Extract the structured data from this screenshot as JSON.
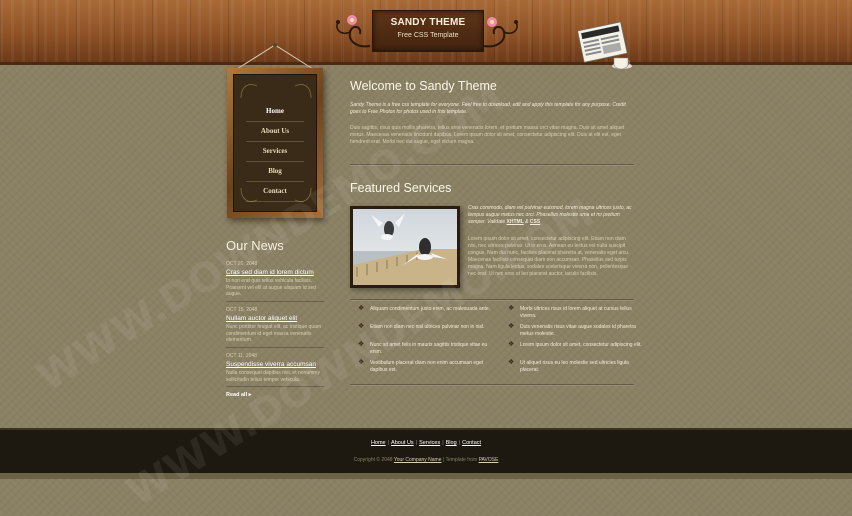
{
  "header": {
    "title": "SANDY THEME",
    "subtitle": "Free CSS Template"
  },
  "nav": {
    "items": [
      {
        "label": "Home",
        "active": true
      },
      {
        "label": "About Us",
        "active": false
      },
      {
        "label": "Services",
        "active": false
      },
      {
        "label": "Blog",
        "active": false
      },
      {
        "label": "Contact",
        "active": false
      }
    ]
  },
  "news": {
    "title": "Our News",
    "items": [
      {
        "date": "OCT 20, 2048",
        "title": "Cras sed diam id lorem dictum",
        "text": "In non erat quis tellus vehicula facilisis. Praesent vel elit at augue aliquam id sed augue."
      },
      {
        "date": "OCT 15, 2048",
        "title": "Nullam auctor aliquet elit",
        "text": "Nunc porttitor feugiat elit, ac tristique quam condimentum id eget massa venenatis elementum."
      },
      {
        "date": "OCT 11, 2048",
        "title": "Suspendisse viverra accumsan",
        "text": "Nulla consequat dapibus nisi, et nonummy sollicitudin tellus tempor vehicula."
      }
    ],
    "read_all": "Read all"
  },
  "welcome": {
    "title": "Welcome to Sandy Theme",
    "intro": "Sandy Theme is a free css template for everyone. Feel free to download, edit and apply this template for any purpose. Credit goes to Free Photos for photos used in this template.",
    "body": "Duis sagittis, risus quis mollis pharetra, tellus ante venenatis lorem, et pretium massa orci vitae magna. Duis sit amet aliquet metus. Maecenas venenatis tincidunt dapibus. Lorem ipsum dolor sit amet, consectetur adipiscing elit. Duis at elit est, eget hendrerit erat. Morbi nec dui augue, eget dictum magna."
  },
  "featured": {
    "title": "Featured Services",
    "intro": "Cras commodo, diam vel pulvinar euismod, lorem magna ultrices justo, ac tempus augue metus nec orci. Phasellus molestie urna et mi pretium semper. Validate",
    "validate_xhtml": "XHTML",
    "validate_and": "&",
    "validate_css": "CSS",
    "body": "Lorem ipsum dolor sit amet, consectetur adipiscing elit. Etiam non diam nisi, nec ultrices pulvinar. Ut in eros. Aenean eu lectus vel nulla suscipit congue. Nam dui nunc, facilisis placerat pharetra at, venenatis eget arcu. Maecenas facilisis consequat diam non accumsan. Phasellus sed turpis magna. Nam ligula lectus, sodales scelerisque viverra non, pellentesque nec erat. Ut nec eros ut leo placerat auctor, iaculis facilisis.",
    "bullets_left": [
      "Aliquam condimentum justo enim, ac malesuada ante.",
      "Etiam non diam nec nisl ultrices pulvinar non in nisl.",
      "Nunc sit amet felis in mauris sagittis tristique vitae eu enim.",
      "Vestibulum placerat diam non enim accumsan eget dapibus est."
    ],
    "bullets_right": [
      "Morbi ultrices risus id lorem aliquet at cursus tellus viverra.",
      "Duis venenatis risus vitae augue sodales id pharetra metus molestie.",
      "Lorem ipsum dolor sit amet, consectetur adipiscing elit.",
      "Ut aliquet risus eu leo molestie sed ultricies ligula placerat."
    ]
  },
  "footer": {
    "links": [
      "Home",
      "About Us",
      "Services",
      "Blog",
      "Contact"
    ],
    "copyright_prefix": "Copyright © 2048",
    "company": "Your Company Name",
    "designed_by": "| Template from",
    "designer": "PAVOSE"
  },
  "watermark": "WWW.DOWNDEMO.COM",
  "colors": {
    "background": "#8a8064",
    "wood": "#8e5226",
    "footer": "#1e1910",
    "menu_board": "#3a2a18"
  }
}
